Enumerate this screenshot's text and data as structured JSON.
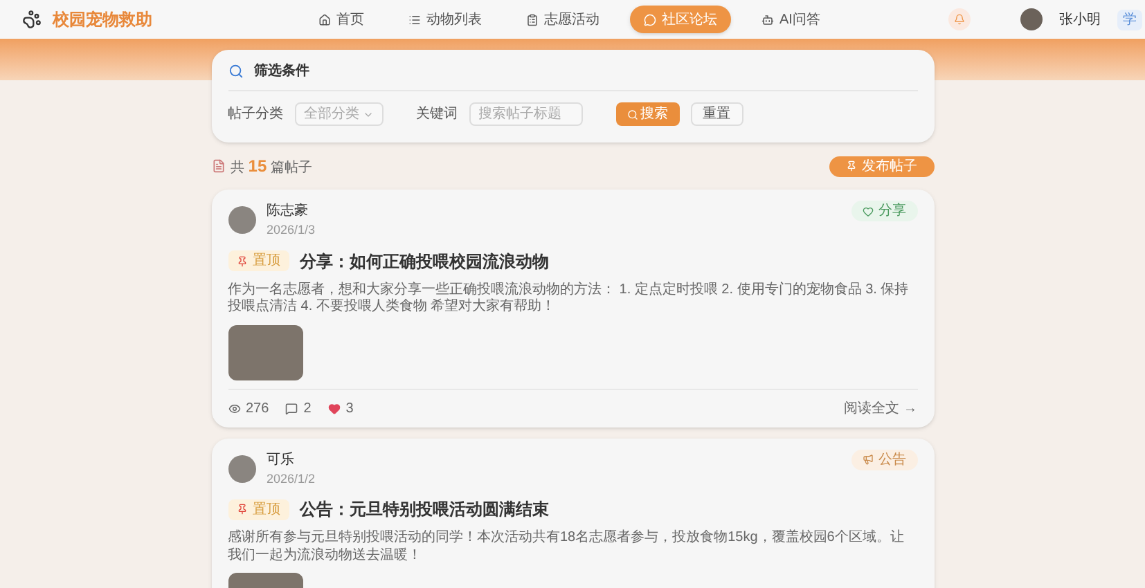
{
  "brand": {
    "name": "校园宠物救助"
  },
  "nav": [
    {
      "label": "首页",
      "selected": false
    },
    {
      "label": "动物列表",
      "selected": false
    },
    {
      "label": "志愿活动",
      "selected": false
    },
    {
      "label": "社区论坛",
      "selected": true
    },
    {
      "label": "AI问答",
      "selected": false
    }
  ],
  "user": {
    "name": "张小明",
    "role": "学"
  },
  "filter": {
    "title": "筛选条件",
    "category_label": "帖子分类",
    "category_value": "全部分类",
    "keyword_label": "关键词",
    "keyword_placeholder": "搜索帖子标题",
    "search_button": "搜索",
    "reset_button": "重置"
  },
  "summary": {
    "prefix": "共",
    "count": "15",
    "suffix": "篇帖子",
    "publish_button": "发布帖子"
  },
  "posts": [
    {
      "author": "陈志豪",
      "date": "2026/1/3",
      "pinned": true,
      "pin_label": "置顶",
      "title": "分享：如何正确投喂校园流浪动物",
      "category": "分享",
      "kind": "share",
      "excerpt": "作为一名志愿者，想和大家分享一些正确投喂流浪动物的方法： 1. 定点定时投喂 2. 使用专门的宠物食品 3. 保持投喂点清洁 4. 不要投喂人类食物 希望对大家有帮助！",
      "views": "276",
      "comments": "2",
      "likes": "3",
      "read_more": "阅读全文 →"
    },
    {
      "author": "可乐",
      "date": "2026/1/2",
      "pinned": true,
      "pin_label": "置顶",
      "title": "公告：元旦特别投喂活动圆满结束",
      "category": "公告",
      "kind": "notice",
      "excerpt": "感谢所有参与元旦特别投喂活动的同学！本次活动共有18名志愿者参与，投放食物15kg，覆盖校园6个区域。让我们一起为流浪动物送去温暖！"
    }
  ]
}
